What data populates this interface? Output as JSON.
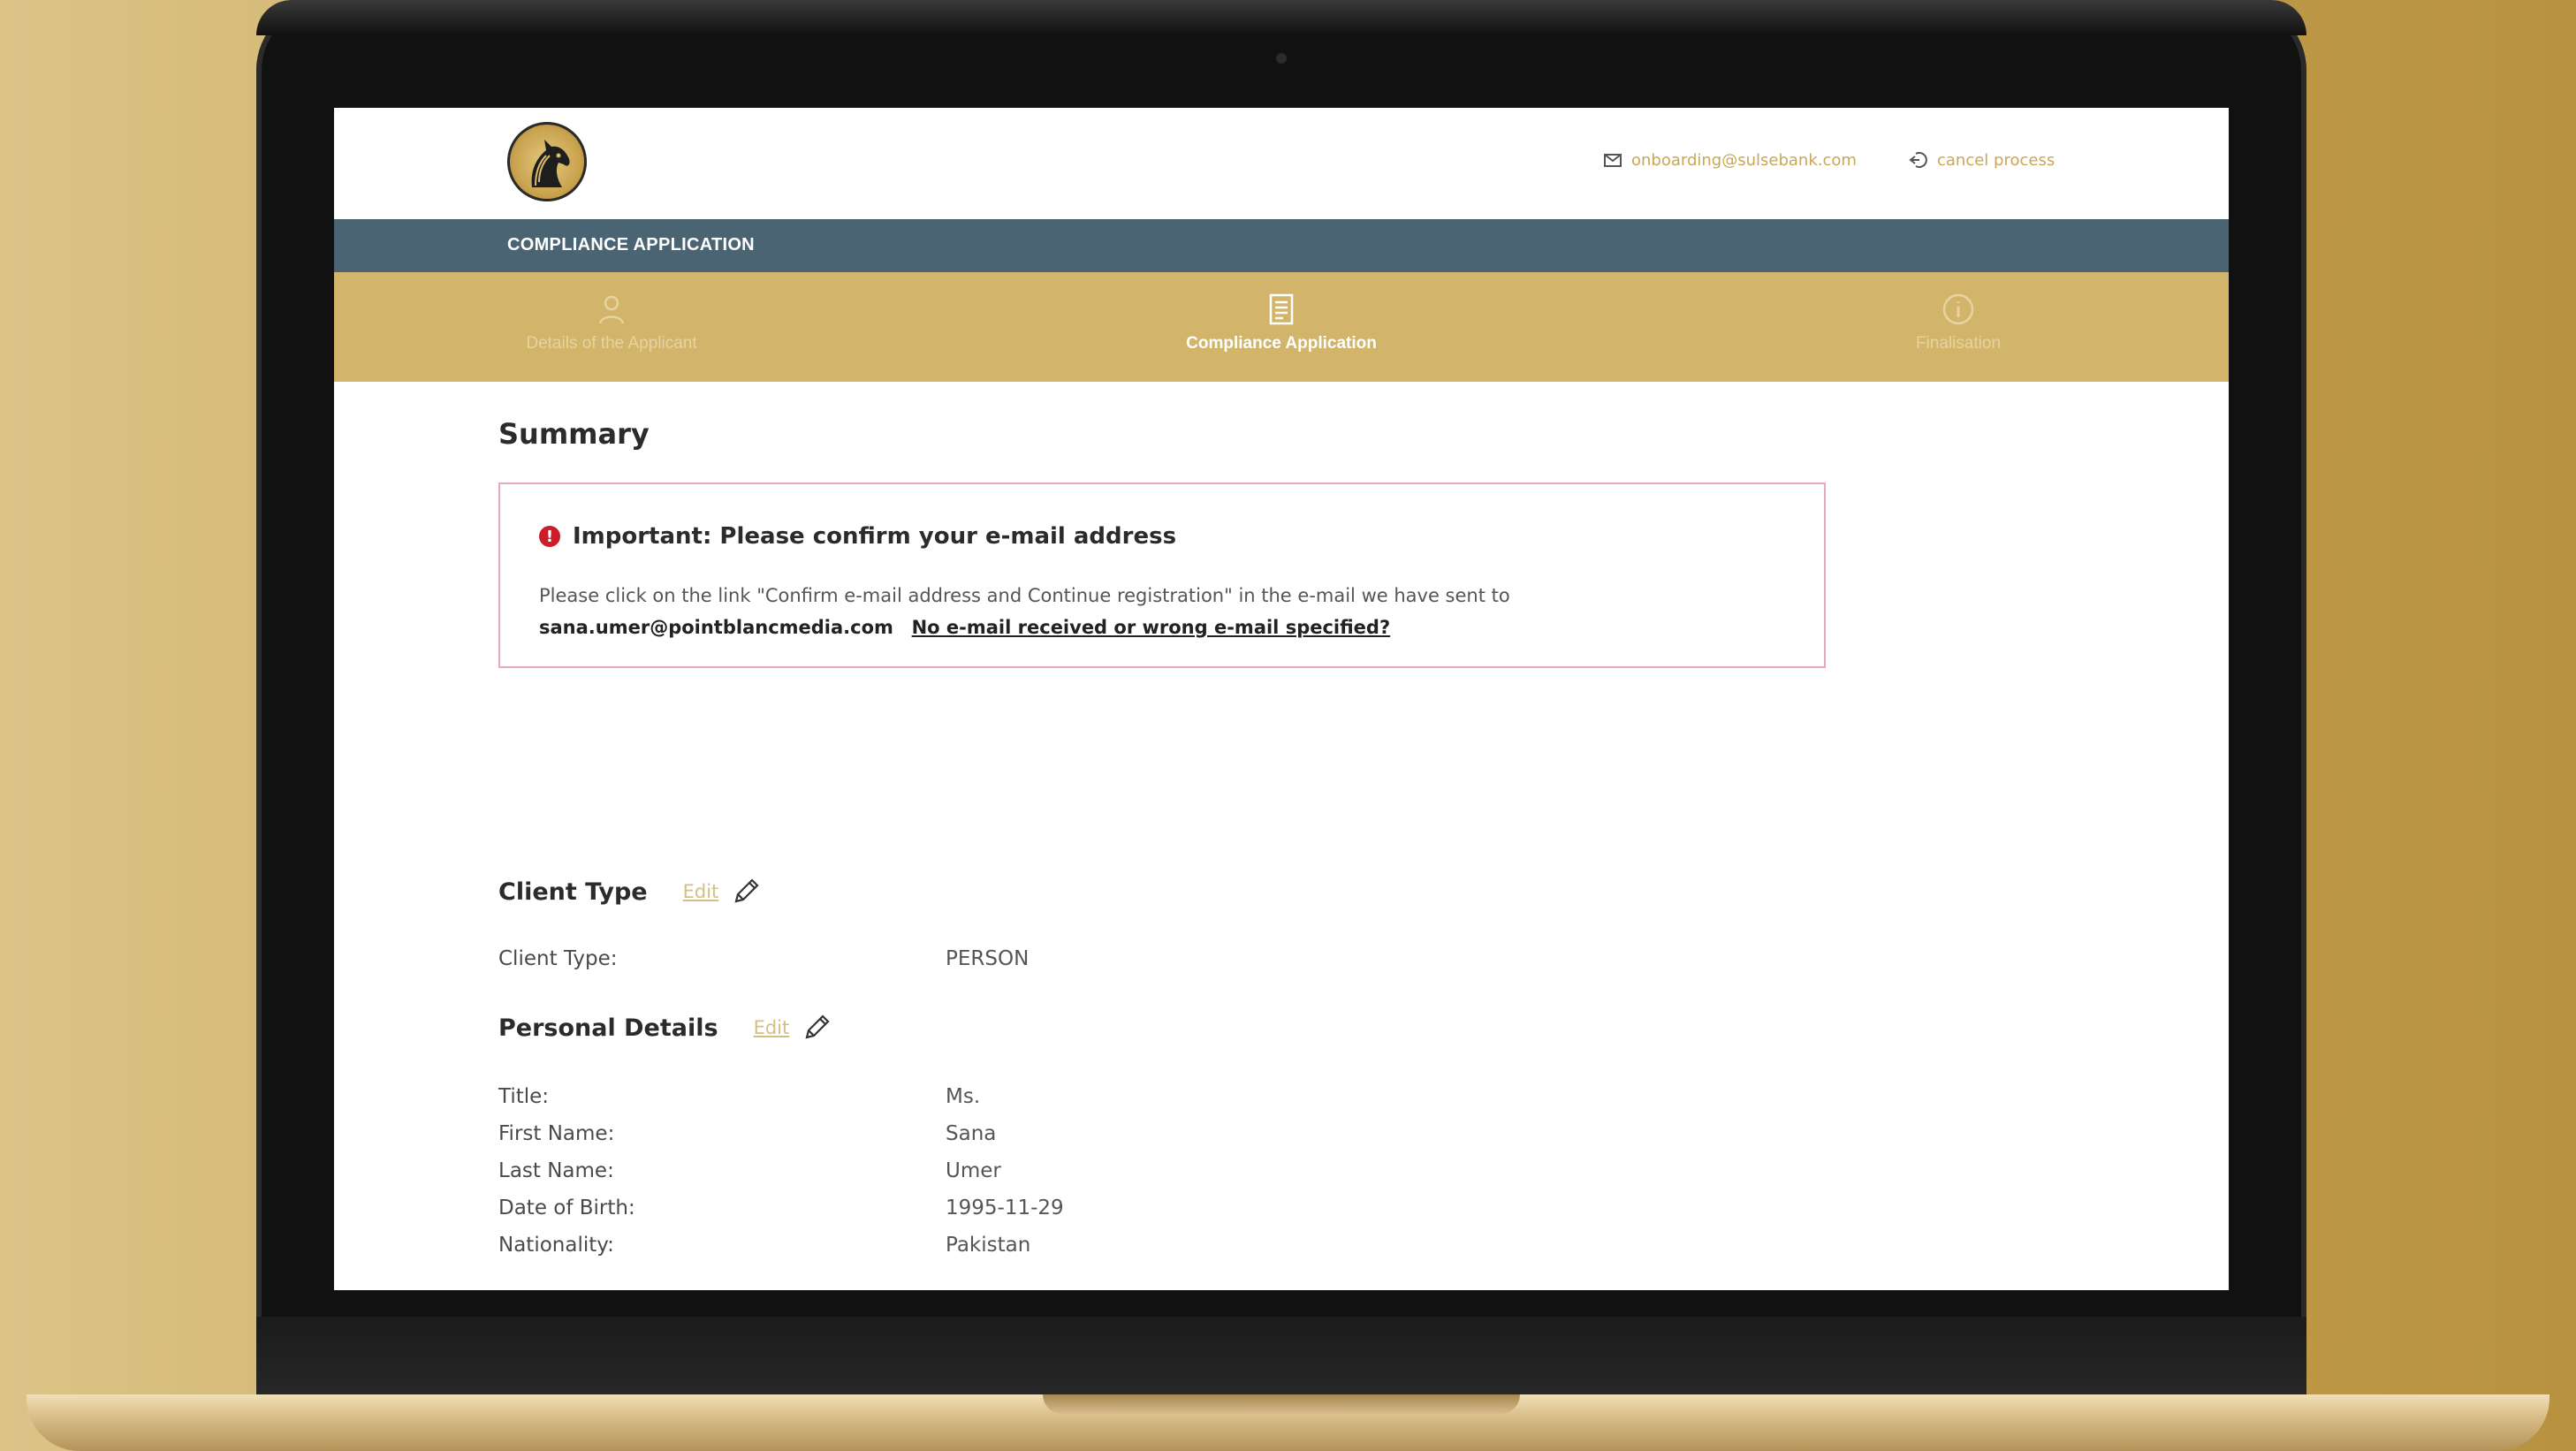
{
  "header": {
    "email_link": "onboarding@sulsebank.com",
    "cancel_link": "cancel process",
    "app_title": "COMPLIANCE APPLICATION"
  },
  "steps": [
    {
      "label": "Details of the Applicant",
      "icon": "person-icon",
      "state": "inactive"
    },
    {
      "label": "Compliance Application",
      "icon": "document-icon",
      "state": "active"
    },
    {
      "label": "Finalisation",
      "icon": "info-icon",
      "state": "inactive"
    }
  ],
  "summary": {
    "title": "Summary",
    "alert": {
      "heading": "Important: Please confirm your e-mail address",
      "body": "Please click on the link \"Confirm e-mail address and Continue registration\" in the e-mail we have sent to",
      "email": "sana.umer@pointblancmedia.com",
      "link": "No e-mail received or wrong e-mail specified?"
    }
  },
  "client_type": {
    "heading": "Client Type",
    "edit_label": "Edit",
    "fields": [
      {
        "label": "Client Type:",
        "value": "PERSON"
      }
    ]
  },
  "personal_details": {
    "heading": "Personal Details",
    "edit_label": "Edit",
    "fields": [
      {
        "label": "Title:",
        "value": "Ms."
      },
      {
        "label": "First Name:",
        "value": "Sana"
      },
      {
        "label": "Last Name:",
        "value": "Umer"
      },
      {
        "label": "Date of Birth:",
        "value": "1995-11-29"
      },
      {
        "label": "Nationality:",
        "value": "Pakistan"
      }
    ]
  },
  "colors": {
    "accent_gold": "#d2b56a",
    "title_bar": "#4b6473",
    "alert_border": "#e9a9bd",
    "alert_icon": "#cc1d2a"
  }
}
